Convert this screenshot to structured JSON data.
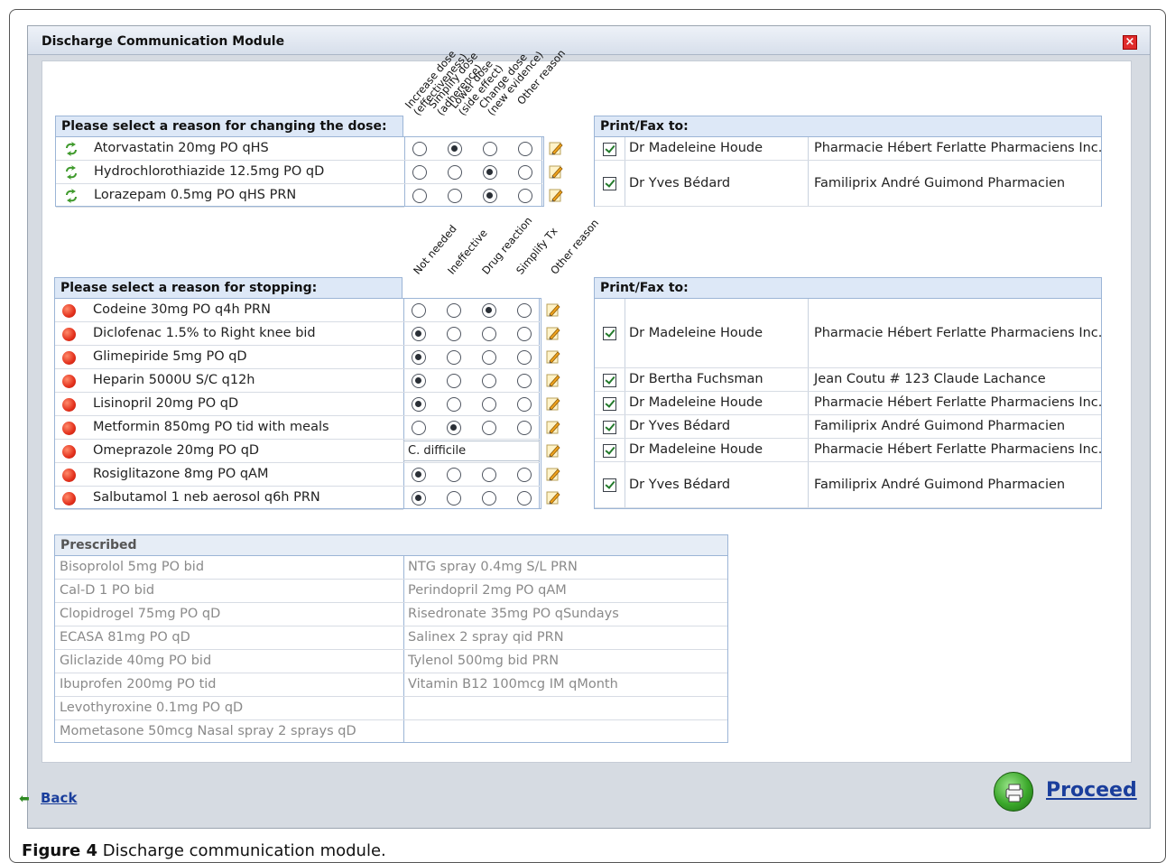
{
  "window": {
    "title": "Discharge Communication Module"
  },
  "dose_section": {
    "header": "Please select a reason for changing the dose:",
    "columns": [
      "Increase dose\n(effectiveness)",
      "Simplify dose\n(adherence)",
      "Lower dose\n(side effect)",
      "Change dose\n(new evidence)",
      "Other reason"
    ],
    "rows": [
      {
        "drug": "Atorvastatin 20mg PO qHS",
        "selected": 1
      },
      {
        "drug": "Hydrochlorothiazide 12.5mg PO qD",
        "selected": 2
      },
      {
        "drug": "Lorazepam 0.5mg PO qHS PRN",
        "selected": 2
      }
    ],
    "print_fax": {
      "header": "Print/Fax to:",
      "rows": [
        {
          "doctor": "Dr Madeleine Houde",
          "pharmacy": "Pharmacie Hébert Ferlatte Pharmaciens Inc.",
          "checked": true
        },
        {
          "doctor": "Dr Yves Bédard",
          "pharmacy": "Familiprix André Guimond Pharmacien",
          "checked": true
        }
      ]
    }
  },
  "stop_section": {
    "header": "Please select a reason for stopping:",
    "columns": [
      "Not needed",
      "Ineffective",
      "Drug reaction",
      "Simplify Tx",
      "Other reason"
    ],
    "rows": [
      {
        "drug": "Codeine 30mg PO q4h PRN",
        "selected": 2
      },
      {
        "drug": "Diclofenac 1.5% to Right knee bid",
        "selected": 0
      },
      {
        "drug": "Glimepiride 5mg PO qD",
        "selected": 0
      },
      {
        "drug": "Heparin 5000U S/C q12h",
        "selected": 0
      },
      {
        "drug": "Lisinopril 20mg PO qD",
        "selected": 0
      },
      {
        "drug": "Metformin 850mg PO tid with meals",
        "selected": 1
      },
      {
        "drug": "Omeprazole 20mg PO qD",
        "selected": -1,
        "other_text": "C. difficile"
      },
      {
        "drug": "Rosiglitazone 8mg PO qAM",
        "selected": 0
      },
      {
        "drug": "Salbutamol 1 neb aerosol q6h PRN",
        "selected": 0
      }
    ],
    "print_fax": {
      "header": "Print/Fax to:",
      "rows": [
        {
          "doctor": "Dr Madeleine Houde",
          "pharmacy": "Pharmacie Hébert Ferlatte Pharmaciens Inc.",
          "checked": true
        },
        {
          "doctor": "Dr Bertha Fuchsman",
          "pharmacy": "Jean Coutu # 123 Claude Lachance",
          "checked": true
        },
        {
          "doctor": "Dr Madeleine Houde",
          "pharmacy": "Pharmacie Hébert Ferlatte Pharmaciens Inc.",
          "checked": true
        },
        {
          "doctor": "Dr Yves Bédard",
          "pharmacy": "Familiprix André Guimond Pharmacien",
          "checked": true
        },
        {
          "doctor": "Dr Madeleine Houde",
          "pharmacy": "Pharmacie Hébert Ferlatte Pharmaciens Inc.",
          "checked": true
        },
        {
          "doctor": "Dr Yves Bédard",
          "pharmacy": "Familiprix André Guimond Pharmacien",
          "checked": true
        }
      ]
    }
  },
  "prescribed": {
    "header": "Prescribed",
    "left": [
      "Bisoprolol 5mg PO bid",
      "Cal-D 1 PO bid",
      "Clopidrogel 75mg PO qD",
      "ECASA 81mg PO qD",
      "Gliclazide 40mg PO bid",
      "Ibuprofen 200mg PO tid",
      "Levothyroxine 0.1mg PO qD",
      "Mometasone 50mcg Nasal spray 2 sprays qD"
    ],
    "right": [
      "NTG spray 0.4mg S/L PRN",
      "Perindopril 2mg PO qAM",
      "Risedronate 35mg PO qSundays",
      "Salinex 2 spray qid PRN",
      "Tylenol 500mg bid PRN",
      "Vitamin B12 100mcg IM qMonth"
    ]
  },
  "footer": {
    "back": "Back",
    "proceed": "Proceed"
  },
  "caption": {
    "label": "Figure 4",
    "text": "Discharge communication module."
  },
  "icons": {
    "dose_change": "recycle-arrows-icon",
    "stop": "red-dot-icon",
    "edit": "pencil-icon",
    "print": "printer-icon",
    "back": "left-arrow-icon",
    "close": "close-icon"
  }
}
